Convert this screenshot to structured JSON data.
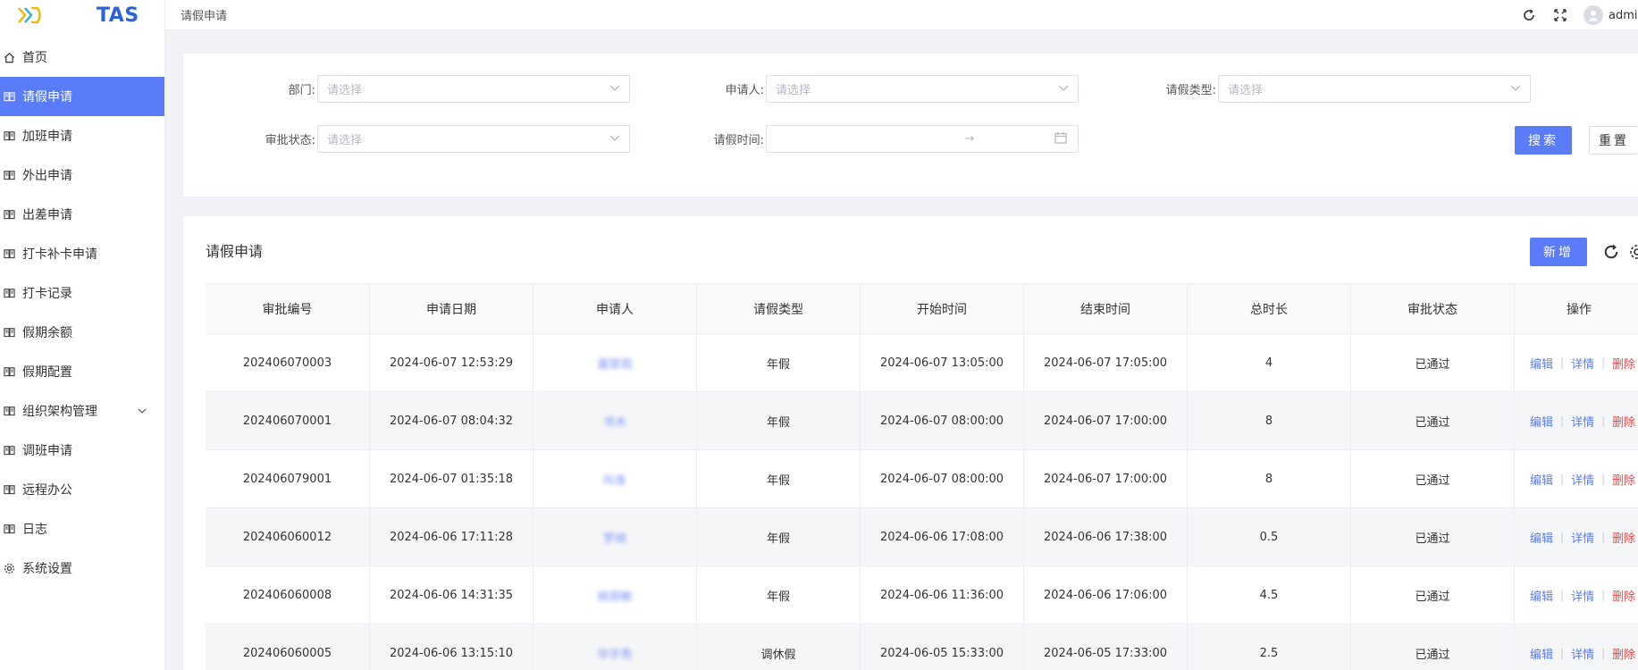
{
  "app": {
    "name": "TAS"
  },
  "breadcrumb": "请假申请",
  "user": {
    "name": "admin"
  },
  "sidebar": {
    "items": [
      {
        "label": "首页",
        "icon": "home-icon"
      },
      {
        "label": "请假申请",
        "icon": "book-icon",
        "active": true
      },
      {
        "label": "加班申请",
        "icon": "book-icon"
      },
      {
        "label": "外出申请",
        "icon": "book-icon"
      },
      {
        "label": "出差申请",
        "icon": "book-icon"
      },
      {
        "label": "打卡补卡申请",
        "icon": "book-icon"
      },
      {
        "label": "打卡记录",
        "icon": "book-icon"
      },
      {
        "label": "假期余额",
        "icon": "book-icon"
      },
      {
        "label": "假期配置",
        "icon": "book-icon"
      },
      {
        "label": "组织架构管理",
        "icon": "book-icon",
        "expandable": true
      },
      {
        "label": "调班申请",
        "icon": "book-icon"
      },
      {
        "label": "远程办公",
        "icon": "book-icon"
      },
      {
        "label": "日志",
        "icon": "book-icon"
      },
      {
        "label": "系统设置",
        "icon": "gear-icon"
      }
    ]
  },
  "filters": {
    "dept_label": "部门:",
    "applicant_label": "申请人:",
    "leave_type_label": "请假类型:",
    "status_label": "审批状态:",
    "time_label": "请假时间:",
    "placeholder": "请选择",
    "date_separator": "→",
    "search_button": "搜索",
    "reset_button": "重置"
  },
  "table": {
    "title": "请假申请",
    "add_button": "新增",
    "columns": [
      "审批编号",
      "申请日期",
      "申请人",
      "请假类型",
      "开始时间",
      "结束时间",
      "总时长",
      "审批状态",
      "操作"
    ],
    "actions": {
      "edit": "编辑",
      "detail": "详情",
      "delete": "删除"
    },
    "rows": [
      {
        "id": "202406070003",
        "date": "2024-06-07 12:53:29",
        "applicant": "嘉禁观",
        "type": "年假",
        "start": "2024-06-07 13:05:00",
        "end": "2024-06-07 17:05:00",
        "duration": "4",
        "status": "已通过"
      },
      {
        "id": "202406070001",
        "date": "2024-06-07 08:04:32",
        "applicant": "书木",
        "type": "年假",
        "start": "2024-06-07 08:00:00",
        "end": "2024-06-07 17:00:00",
        "duration": "8",
        "status": "已通过"
      },
      {
        "id": "202406079001",
        "date": "2024-06-07 01:35:18",
        "applicant": "叫身",
        "type": "年假",
        "start": "2024-06-07 08:00:00",
        "end": "2024-06-07 17:00:00",
        "duration": "8",
        "status": "已通过"
      },
      {
        "id": "202406060012",
        "date": "2024-06-06 17:11:28",
        "applicant": "罗纳",
        "type": "年假",
        "start": "2024-06-06 17:08:00",
        "end": "2024-06-06 17:38:00",
        "duration": "0.5",
        "status": "已通过"
      },
      {
        "id": "202406060008",
        "date": "2024-06-06 14:31:35",
        "applicant": "姚丽敏",
        "type": "年假",
        "start": "2024-06-06 11:36:00",
        "end": "2024-06-06 17:06:00",
        "duration": "4.5",
        "status": "已通过"
      },
      {
        "id": "202406060005",
        "date": "2024-06-06 13:15:10",
        "applicant": "华宇秀",
        "type": "调休假",
        "start": "2024-06-05 15:33:00",
        "end": "2024-06-05 17:33:00",
        "duration": "2.5",
        "status": "已通过"
      }
    ]
  }
}
